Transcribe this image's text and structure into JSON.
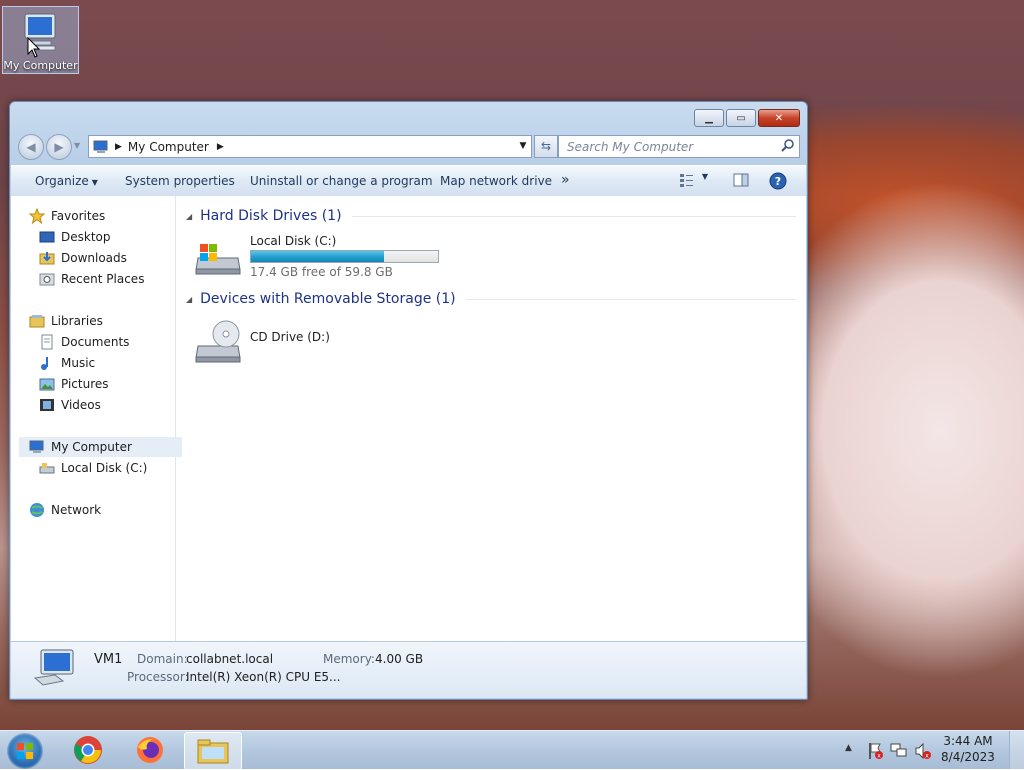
{
  "desktop": {
    "icon_label": "My Computer"
  },
  "window": {
    "address": {
      "path": [
        "My Computer"
      ]
    },
    "search": {
      "placeholder": "Search My Computer"
    },
    "toolbar": {
      "organize": "Organize",
      "system_properties": "System properties",
      "uninstall": "Uninstall or change a program",
      "map_drive": "Map network drive",
      "more": "»"
    },
    "nav": {
      "favorites": "Favorites",
      "desktop": "Desktop",
      "downloads": "Downloads",
      "recent": "Recent Places",
      "libraries": "Libraries",
      "documents": "Documents",
      "music": "Music",
      "pictures": "Pictures",
      "videos": "Videos",
      "my_computer": "My Computer",
      "local_disk": "Local Disk (C:)",
      "network": "Network"
    },
    "groups": {
      "hdd": {
        "title": "Hard Disk Drives (1)"
      },
      "removable": {
        "title": "Devices with Removable Storage (1)"
      }
    },
    "drives": {
      "c": {
        "name": "Local Disk (C:)",
        "free": "17.4 GB free of 59.8 GB",
        "used_fraction": 0.709
      },
      "d": {
        "name": "CD Drive (D:)"
      }
    },
    "details": {
      "name": "VM1",
      "domain_label": "Domain:",
      "domain": "collabnet.local",
      "memory_label": "Memory:",
      "memory": "4.00 GB",
      "processor_label": "Processor:",
      "processor": "Intel(R) Xeon(R) CPU E5..."
    }
  },
  "taskbar": {
    "apps": [
      "chrome-icon",
      "firefox-icon",
      "explorer-icon"
    ],
    "time": "3:44 AM",
    "date": "8/4/2023"
  }
}
